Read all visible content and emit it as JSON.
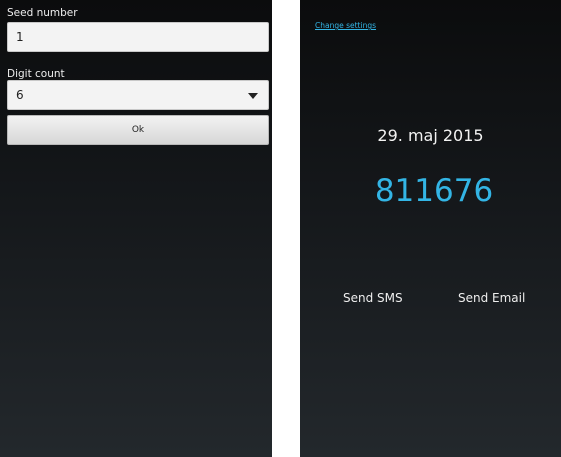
{
  "settings_screen": {
    "seed": {
      "label": "Seed number",
      "value": "1"
    },
    "digits": {
      "label": "Digit count",
      "selected": "6"
    },
    "ok_label": "Ok"
  },
  "result_screen": {
    "change_settings_link": "Change settings",
    "date": "29. maj 2015",
    "code": "811676",
    "send_sms_label": "Send SMS",
    "send_email_label": "Send Email"
  },
  "colors": {
    "accent": "#33b5e5",
    "background": "#15181b"
  }
}
